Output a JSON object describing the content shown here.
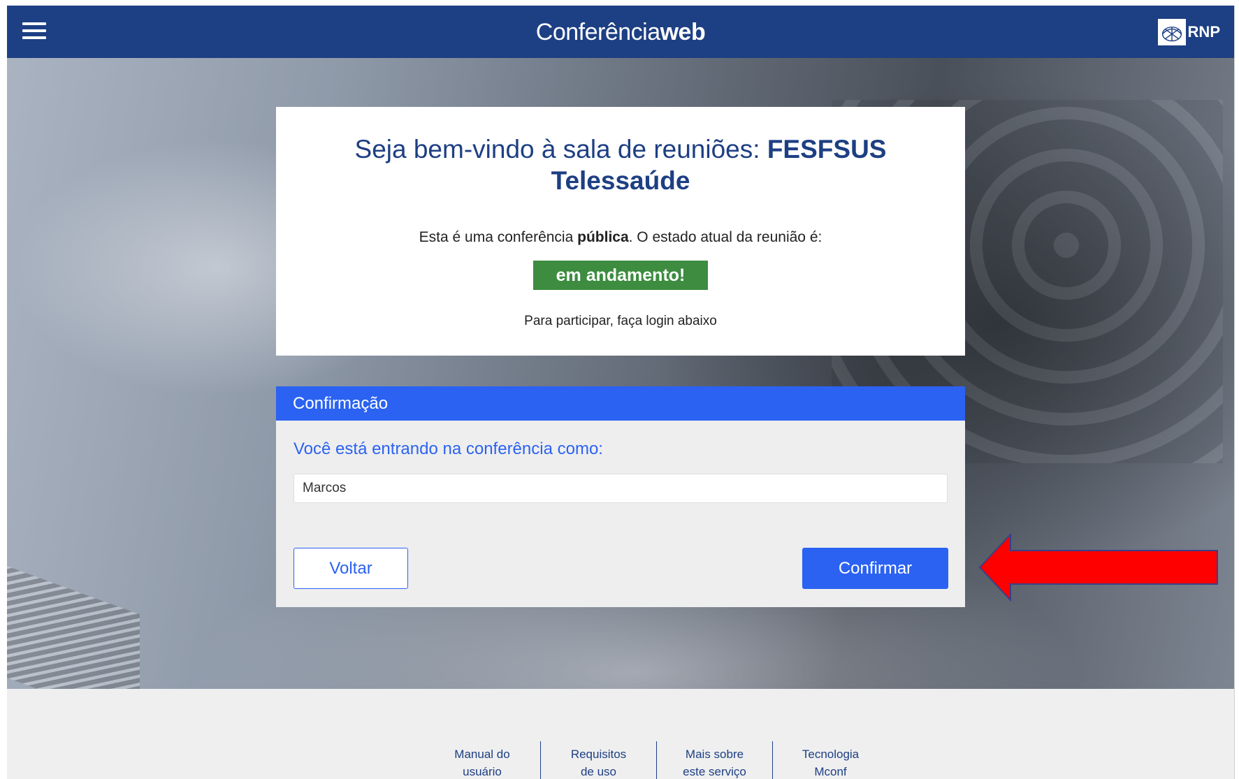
{
  "header": {
    "brand_light": "Conferência",
    "brand_bold": "web",
    "logo_text": "RNP",
    "menu_icon": "hamburger-menu-icon",
    "bg_color": "#1d3f83"
  },
  "welcome": {
    "title_prefix": "Seja bem-vindo à sala de reuniões: ",
    "room_name": "FESFSUS Telessaúde",
    "status_pre": "Esta é uma conferência ",
    "status_bold": "pública",
    "status_post": ". O estado atual da reunião é:",
    "status_badge": "em andamento!",
    "hint": "Para participar, faça login abaixo",
    "badge_color": "#3d8c40"
  },
  "confirmation": {
    "header": "Confirmação",
    "prompt": "Você está entrando na conferência como:",
    "name_value": "Marcos",
    "back_label": "Voltar",
    "confirm_label": "Confirmar",
    "accent_color": "#2b62f2"
  },
  "annotation": {
    "arrow_color": "#ff0000",
    "arrow_icon": "red-pointer-arrow"
  },
  "footer": {
    "links": [
      {
        "line1": "Manual do",
        "line2": "usuário"
      },
      {
        "line1": "Requisitos",
        "line2": "de uso"
      },
      {
        "line1": "Mais sobre",
        "line2": "este serviço"
      },
      {
        "line1": "Tecnologia",
        "line2": "Mconf"
      }
    ]
  }
}
